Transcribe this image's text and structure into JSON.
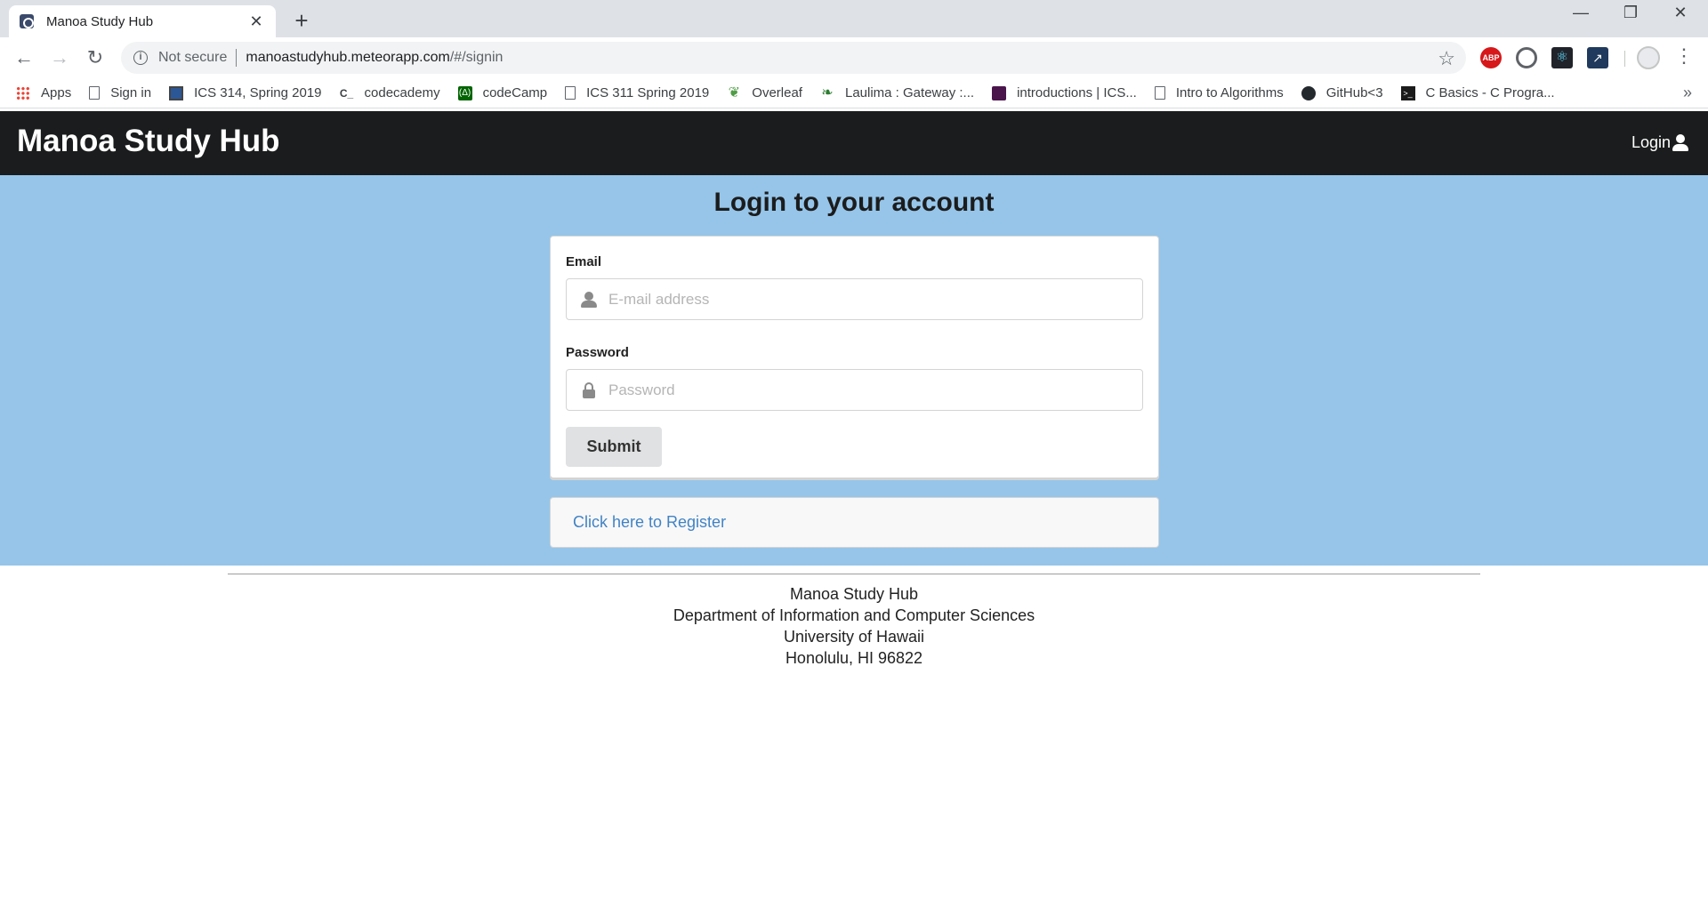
{
  "browser": {
    "tab_title": "Manoa Study Hub",
    "tab_close": "✕",
    "new_tab": "+",
    "window_controls": {
      "minimize": "—",
      "maximize": "❐",
      "close": "✕"
    },
    "security_label": "Not secure",
    "url_host": "manoastudyhub.meteorapp.com",
    "url_path": "/#/signin",
    "bookmarks": [
      {
        "label": "Apps",
        "icon": "apps-grid-icon"
      },
      {
        "label": "Sign in",
        "icon": "page-icon"
      },
      {
        "label": "ICS 314, Spring 2019",
        "icon": "ics314-icon"
      },
      {
        "label": "codecademy",
        "icon": "codecademy-icon"
      },
      {
        "label": "codeCamp",
        "icon": "codecamp-icon"
      },
      {
        "label": "ICS 311 Spring 2019",
        "icon": "page-icon"
      },
      {
        "label": "Overleaf",
        "icon": "overleaf-icon"
      },
      {
        "label": "Laulima : Gateway :...",
        "icon": "laulima-icon"
      },
      {
        "label": "introductions | ICS...",
        "icon": "slack-icon"
      },
      {
        "label": "Intro to Algorithms",
        "icon": "page-icon"
      },
      {
        "label": "GitHub<3",
        "icon": "github-icon"
      },
      {
        "label": "C Basics - C Progra...",
        "icon": "terminal-icon"
      }
    ],
    "bookmarks_overflow": "»"
  },
  "navbar": {
    "brand": "Manoa Study Hub",
    "login_label": "Login"
  },
  "signin": {
    "title": "Login to your account",
    "email_label": "Email",
    "email_placeholder": "E-mail address",
    "email_value": "",
    "password_label": "Password",
    "password_placeholder": "Password",
    "password_value": "",
    "submit_label": "Submit",
    "register_link": "Click here to Register"
  },
  "footer": {
    "line1": "Manoa Study Hub",
    "line2": "Department of Information and Computer Sciences",
    "line3": "University of Hawaii",
    "line4": "Honolulu, HI 96822"
  },
  "colors": {
    "navbar_bg": "#1b1c1d",
    "hero_bg": "#96c5e9",
    "link": "#4183c4",
    "button_bg": "#e0e1e2"
  }
}
